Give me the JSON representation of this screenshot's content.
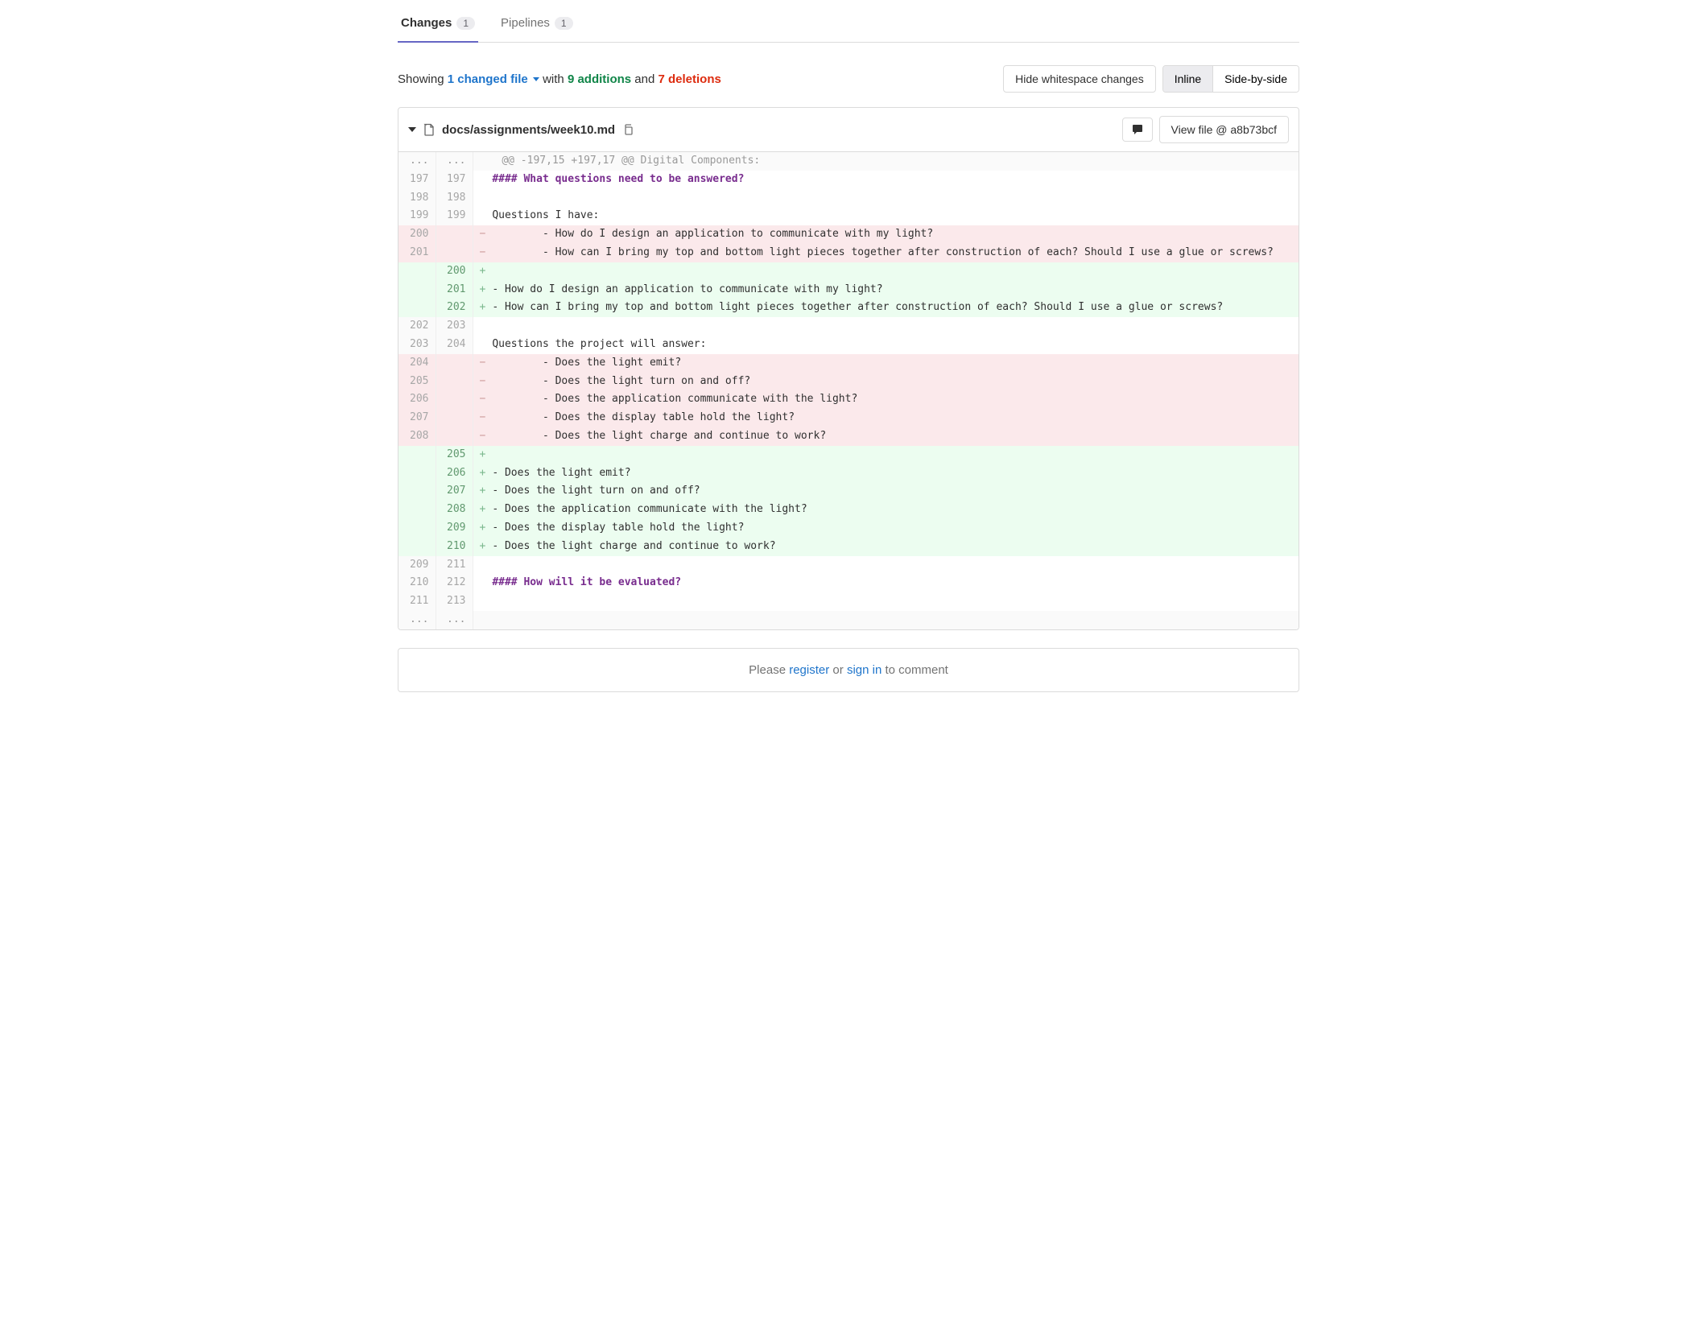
{
  "tabs": {
    "changes": {
      "label": "Changes",
      "count": "1"
    },
    "pipelines": {
      "label": "Pipelines",
      "count": "1"
    }
  },
  "summary": {
    "showing": "Showing ",
    "files_link": "1 changed file",
    "with": " with ",
    "additions": "9 additions",
    "and": " and ",
    "deletions": "7 deletions"
  },
  "buttons": {
    "hide_ws": "Hide whitespace changes",
    "inline": "Inline",
    "sbs": "Side-by-side",
    "view_file": "View file @ a8b73bcf"
  },
  "file": {
    "path": "docs/assignments/week10.md"
  },
  "diff": {
    "hunk": "@@ -197,15 +197,17 @@ Digital Components:",
    "rows": [
      {
        "type": "ctx",
        "old": "197",
        "new": "197",
        "text": "#### What questions need to be answered?",
        "heading": true
      },
      {
        "type": "ctx",
        "old": "198",
        "new": "198",
        "text": ""
      },
      {
        "type": "ctx",
        "old": "199",
        "new": "199",
        "text": "Questions I have:"
      },
      {
        "type": "del",
        "old": "200",
        "new": "",
        "text": "        - How do I design an application to communicate with my light?"
      },
      {
        "type": "del",
        "old": "201",
        "new": "",
        "text": "        - How can I bring my top and bottom light pieces together after construction of each? Should I use a glue or screws?"
      },
      {
        "type": "add",
        "old": "",
        "new": "200",
        "text": ""
      },
      {
        "type": "add",
        "old": "",
        "new": "201",
        "text": "- How do I design an application to communicate with my light?"
      },
      {
        "type": "add",
        "old": "",
        "new": "202",
        "text": "- How can I bring my top and bottom light pieces together after construction of each? Should I use a glue or screws?"
      },
      {
        "type": "ctx",
        "old": "202",
        "new": "203",
        "text": ""
      },
      {
        "type": "ctx",
        "old": "203",
        "new": "204",
        "text": "Questions the project will answer:"
      },
      {
        "type": "del",
        "old": "204",
        "new": "",
        "text": "        - Does the light emit?"
      },
      {
        "type": "del",
        "old": "205",
        "new": "",
        "text": "        - Does the light turn on and off?"
      },
      {
        "type": "del",
        "old": "206",
        "new": "",
        "text": "        - Does the application communicate with the light?"
      },
      {
        "type": "del",
        "old": "207",
        "new": "",
        "text": "        - Does the display table hold the light?"
      },
      {
        "type": "del",
        "old": "208",
        "new": "",
        "text": "        - Does the light charge and continue to work?"
      },
      {
        "type": "add",
        "old": "",
        "new": "205",
        "text": ""
      },
      {
        "type": "add",
        "old": "",
        "new": "206",
        "text": "- Does the light emit?"
      },
      {
        "type": "add",
        "old": "",
        "new": "207",
        "text": "- Does the light turn on and off?"
      },
      {
        "type": "add",
        "old": "",
        "new": "208",
        "text": "- Does the application communicate with the light?"
      },
      {
        "type": "add",
        "old": "",
        "new": "209",
        "text": "- Does the display table hold the light?"
      },
      {
        "type": "add",
        "old": "",
        "new": "210",
        "text": "- Does the light charge and continue to work?"
      },
      {
        "type": "ctx",
        "old": "209",
        "new": "211",
        "text": ""
      },
      {
        "type": "ctx",
        "old": "210",
        "new": "212",
        "text": "#### How will it be evaluated?",
        "heading": true
      },
      {
        "type": "ctx",
        "old": "211",
        "new": "213",
        "text": ""
      }
    ]
  },
  "comment_prompt": {
    "please": "Please ",
    "register": "register",
    "or": " or ",
    "signin": "sign in",
    "to_comment": " to comment"
  }
}
